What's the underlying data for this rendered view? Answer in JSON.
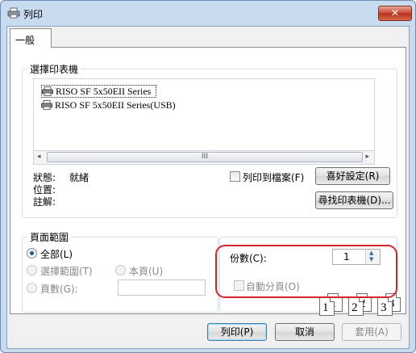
{
  "window": {
    "title": "列印",
    "close_label": "✕"
  },
  "tabs": [
    {
      "label": "一般"
    }
  ],
  "printer_group": {
    "title": "選擇印表機",
    "printers": [
      {
        "name": "RISO SF 5x50EII Series"
      },
      {
        "name": "RISO SF 5x50EII Series(USB)"
      }
    ],
    "scroll_thumb": "III",
    "scroll_left": "◂",
    "scroll_right": "▸",
    "status_label": "狀態:",
    "status_value": "就緒",
    "location_label": "位置:",
    "comment_label": "註解:",
    "print_to_file_label": "列印到檔案(F)",
    "preferences_button": "喜好設定(R)",
    "find_printer_button": "尋找印表機(D)..."
  },
  "page_range": {
    "title": "頁面範圍",
    "all_label": "全部(L)",
    "selection_label": "選擇範圍(T)",
    "current_page_label": "本頁(U)",
    "pages_label": "頁數(G):",
    "pages_value": ""
  },
  "copies": {
    "label": "份數(C):",
    "value": "1",
    "collate_label": "自動分頁(O)",
    "collate_pages": [
      "1",
      "1",
      "2",
      "2",
      "3",
      "3"
    ]
  },
  "buttons": {
    "print": "列印(P)",
    "cancel": "取消",
    "apply": "套用(A)"
  },
  "colors": {
    "highlight": "#d2252a",
    "title_bar": "#c9dbee"
  }
}
